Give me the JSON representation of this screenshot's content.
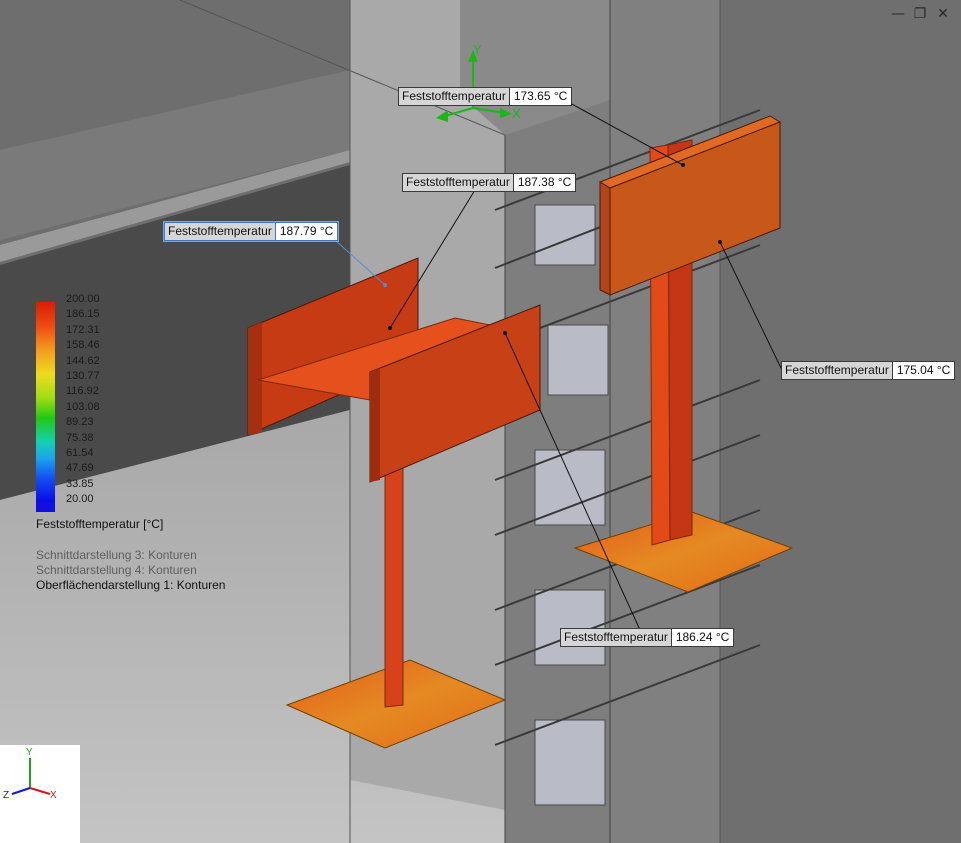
{
  "window_controls": {
    "minimize": "—",
    "restore": "❐",
    "close": "✕"
  },
  "legend": {
    "values": [
      "200.00",
      "186.15",
      "172.31",
      "158.46",
      "144.62",
      "130.77",
      "116.92",
      "103.08",
      "89.23",
      "75.38",
      "61.54",
      "47.69",
      "33.85",
      "20.00"
    ],
    "title": "Feststofftemperatur [°C]",
    "colors": {
      "max": "#d81e05",
      "mid": "#23c814",
      "min": "#0a0ae6"
    }
  },
  "views": [
    {
      "label": "Schnittdarstellung 3: Konturen",
      "active": false
    },
    {
      "label": "Schnittdarstellung 4: Konturen",
      "active": false
    },
    {
      "label": "Oberflächendarstellung 1: Konturen",
      "active": true
    }
  ],
  "probes": [
    {
      "label": "Feststofftemperatur",
      "value": "173.65 °C"
    },
    {
      "label": "Feststofftemperatur",
      "value": "187.38 °C"
    },
    {
      "label": "Feststofftemperatur",
      "value": "187.79 °C"
    },
    {
      "label": "Feststofftemperatur",
      "value": "175.04 °C"
    },
    {
      "label": "Feststofftemperatur",
      "value": "186.24 °C"
    }
  ],
  "triad": {
    "x": "X",
    "y": "Y",
    "z": "Z"
  },
  "axis_indicator": {
    "x": "X",
    "y": "Y"
  }
}
